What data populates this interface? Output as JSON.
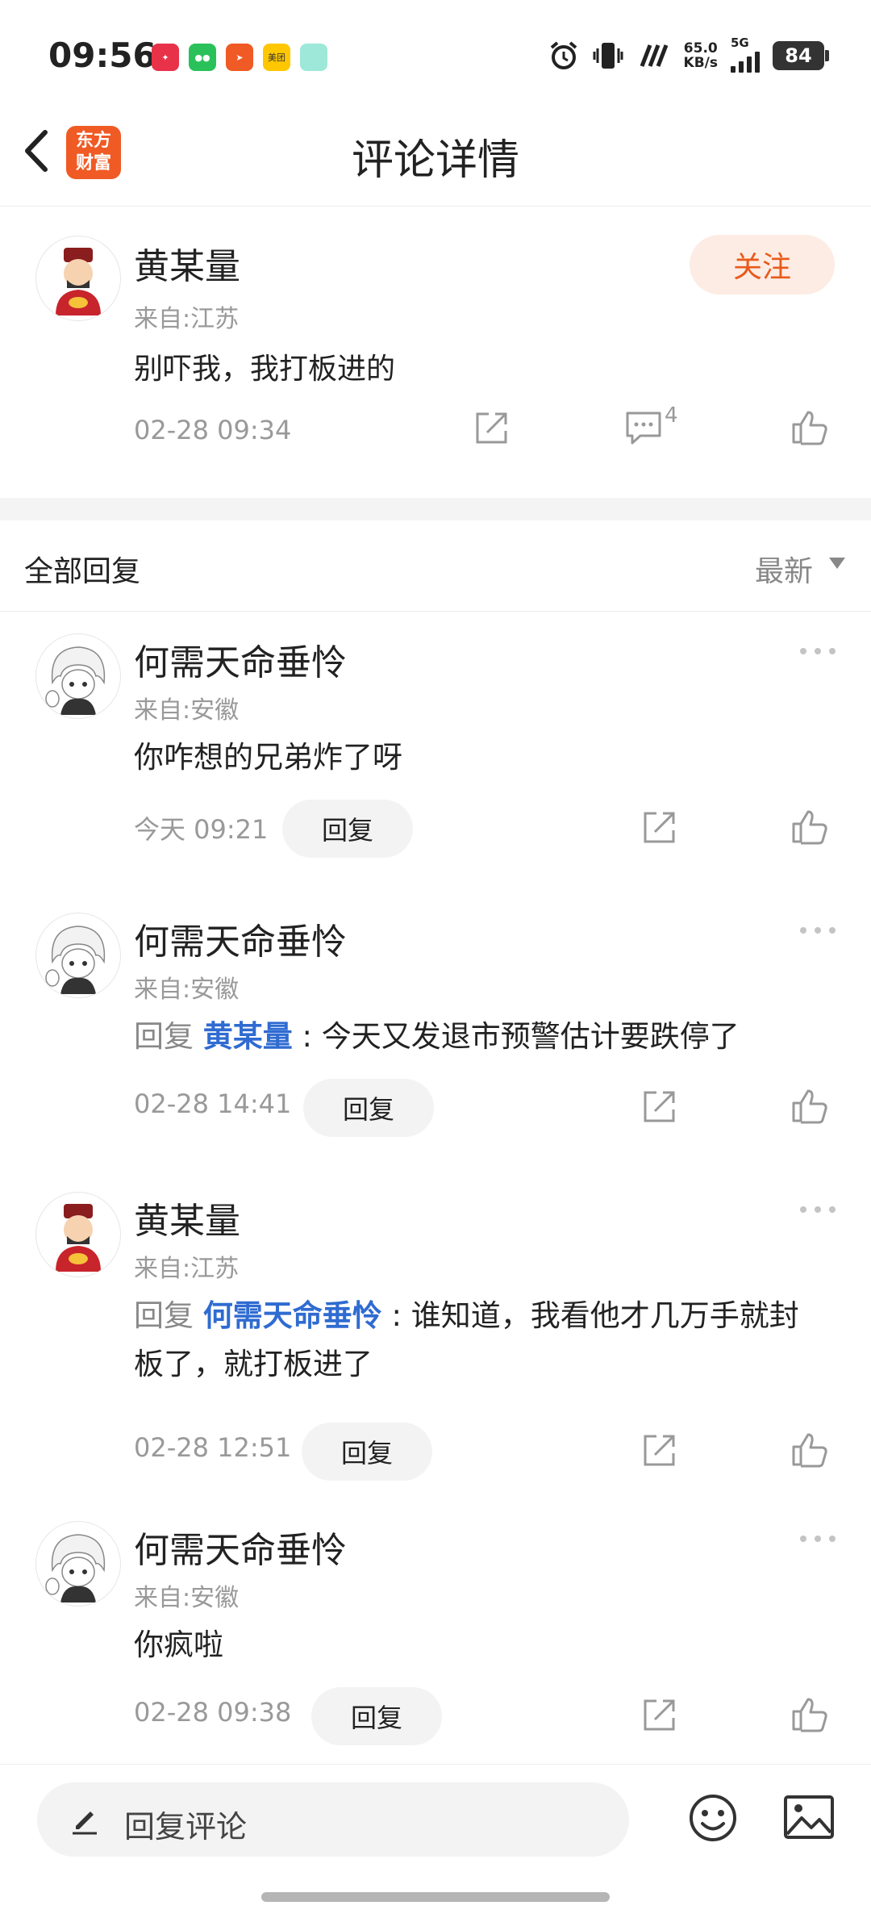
{
  "status_bar": {
    "time": "09:56",
    "net_speed_value": "65.0",
    "net_speed_unit": "KB/s",
    "network": "5G",
    "battery": "84",
    "app_icons": [
      "taobao-flash-icon",
      "wechat-icon",
      "feishu-icon",
      "meituan-icon",
      "teal-app-icon"
    ],
    "meituan_label": "美团"
  },
  "nav": {
    "title": "评论详情",
    "logo_line1": "东方",
    "logo_line2": "财富"
  },
  "post": {
    "author": "黄某量",
    "region": "来自:江苏",
    "content": "别吓我，我打板进的",
    "time": "02-28 09:34",
    "comment_count": "4",
    "follow_label": "关注"
  },
  "replies_header": {
    "title": "全部回复",
    "sort_label": "最新"
  },
  "replies": [
    {
      "author": "何需天命垂怜",
      "region": "来自:安徽",
      "prefix": "",
      "mention": "",
      "text": "你咋想的兄弟炸了呀",
      "time": "今天 09:21",
      "reply_label": "回复"
    },
    {
      "author": "何需天命垂怜",
      "region": "来自:安徽",
      "prefix": "回复 ",
      "mention": "黄某量",
      "text": " : 今天又发退市预警估计要跌停了",
      "time": "02-28 14:41",
      "reply_label": "回复"
    },
    {
      "author": "黄某量",
      "region": "来自:江苏",
      "prefix": "回复 ",
      "mention": "何需天命垂怜",
      "text": " : 谁知道，我看他才几万手就封板了，就打板进了",
      "time": "02-28 12:51",
      "reply_label": "回复"
    },
    {
      "author": "何需天命垂怜",
      "region": "来自:安徽",
      "prefix": "",
      "mention": "",
      "text": "你疯啦",
      "time": "02-28 09:38",
      "reply_label": "回复"
    }
  ],
  "bottom_bar": {
    "input_placeholder": "回复评论"
  },
  "colors": {
    "accent_orange": "#e85a1b",
    "follow_bg": "#fdece4",
    "mention_blue": "#2f6bd1",
    "logo_bg": "#f05a24"
  }
}
